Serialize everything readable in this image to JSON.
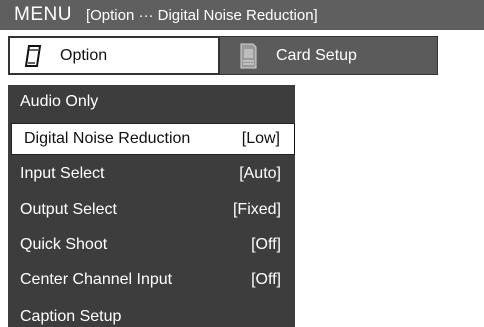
{
  "title_bar": {
    "menu_label": "MENU",
    "context": "[Option ··· Digital Noise Reduction]"
  },
  "tabs": [
    {
      "label": "Option",
      "icon": "option-card-icon",
      "active": true
    },
    {
      "label": "Card Setup",
      "icon": "card-setup-icon",
      "active": false
    }
  ],
  "menu": {
    "items": [
      {
        "label": "Audio Only",
        "value": ""
      },
      {
        "label": "Digital Noise Reduction",
        "value": "[Low]",
        "selected": true
      },
      {
        "label": "Input Select",
        "value": "[Auto]"
      },
      {
        "label": "Output Select",
        "value": "[Fixed]"
      },
      {
        "label": "Quick Shoot",
        "value": "[Off]"
      },
      {
        "label": "Center Channel Input",
        "value": "[Off]"
      },
      {
        "label": "Caption Setup",
        "value": ""
      }
    ]
  },
  "colors": {
    "title_bar_bg": "#5f5f5f",
    "menu_bg": "#3d3d3d",
    "selected_bg": "#ffffff",
    "inactive_tab_bg": "#5b5b5b"
  }
}
